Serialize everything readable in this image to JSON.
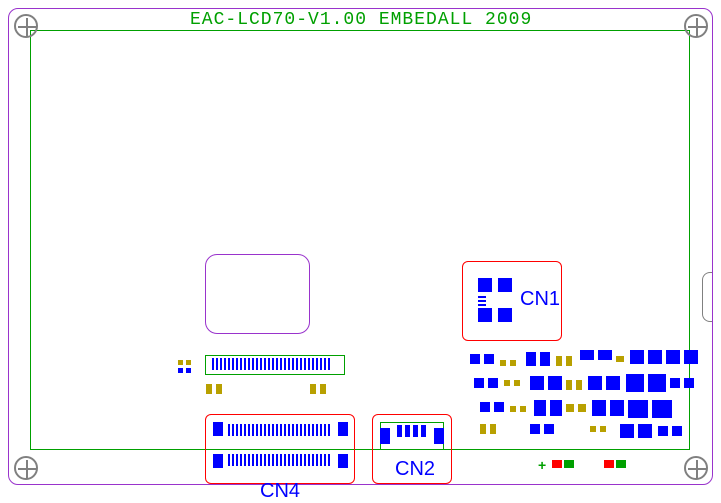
{
  "board": {
    "title": "EAC-LCD70-V1.00  EMBEDALL 2009"
  },
  "connectors": {
    "cn1": {
      "label": "CN1"
    },
    "cn2": {
      "label": "CN2"
    },
    "cn4": {
      "label": "CN4"
    }
  },
  "colors": {
    "silkscreen": "#00a000",
    "outline": "#9933cc",
    "pad": "#0000ff",
    "highlight": "#ff0000"
  }
}
